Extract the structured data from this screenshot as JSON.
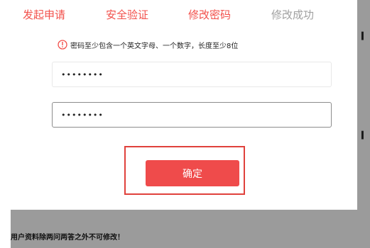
{
  "steps": [
    {
      "label": "发起申请",
      "state": "active"
    },
    {
      "label": "安全验证",
      "state": "active"
    },
    {
      "label": "修改密码",
      "state": "active"
    },
    {
      "label": "修改成功",
      "state": "pending"
    }
  ],
  "hint": {
    "icon": "warning-circle-icon",
    "text": "密码至少包含一个英文字母、一个数字，长度至少8位"
  },
  "form": {
    "new_password": "••••••••",
    "confirm_password": "••••••••"
  },
  "confirm_label": "确定",
  "background": {
    "bottom_text": "用户资料除两问两答之外不可修改！"
  },
  "colors": {
    "accent": "#f2504b",
    "done_step": "#a0a0a0",
    "button": "#ef4b4b",
    "highlight": "#e0413c"
  }
}
